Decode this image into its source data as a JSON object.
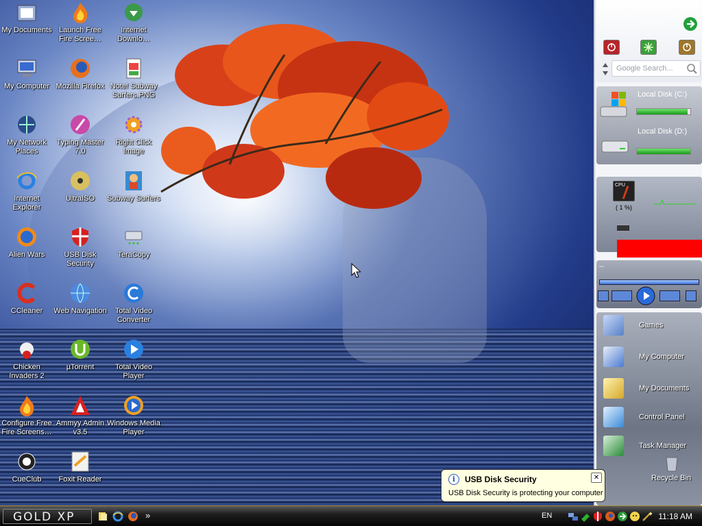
{
  "desktop_icons": [
    {
      "label": "My Documents",
      "icon": "folder-icon"
    },
    {
      "label": "Launch Free Fire Scree…",
      "icon": "flame-icon"
    },
    {
      "label": "Internet Downlo…",
      "icon": "globe-download-icon"
    },
    {
      "label": "My Computer",
      "icon": "computer-icon"
    },
    {
      "label": "Mozilla Firefox",
      "icon": "firefox-icon"
    },
    {
      "label": "Note! Subway Surfers.PNG",
      "icon": "image-file-icon"
    },
    {
      "label": "My Network Places",
      "icon": "network-icon"
    },
    {
      "label": "Typing Master 7.0",
      "icon": "typing-icon"
    },
    {
      "label": "Right Click Image",
      "icon": "gear-icon"
    },
    {
      "label": "Internet Explorer",
      "icon": "ie-icon"
    },
    {
      "label": "UltraISO",
      "icon": "disc-icon"
    },
    {
      "label": "Subway Surfers",
      "icon": "game-icon"
    },
    {
      "label": "Alien Wars",
      "icon": "alien-icon"
    },
    {
      "label": "USB Disk Security",
      "icon": "shield-icon"
    },
    {
      "label": "TeraCopy",
      "icon": "copy-icon"
    },
    {
      "label": "CCleaner",
      "icon": "ccleaner-icon"
    },
    {
      "label": "Web Navigation",
      "icon": "globe-icon"
    },
    {
      "label": "Total Video Converter",
      "icon": "converter-icon"
    },
    {
      "label": "Chicken Invaders 2",
      "icon": "chicken-icon"
    },
    {
      "label": "µTorrent",
      "icon": "utorrent-icon"
    },
    {
      "label": "Total Video Player",
      "icon": "play-icon"
    },
    {
      "label": "Configure Free Fire Screens…",
      "icon": "flame-icon"
    },
    {
      "label": "Ammyy Admin v3.5",
      "icon": "ammyy-icon"
    },
    {
      "label": "Windows Media Player",
      "icon": "media-player-icon"
    },
    {
      "label": "CueClub",
      "icon": "billiard-icon"
    },
    {
      "label": "Foxit Reader",
      "icon": "pdf-icon"
    }
  ],
  "sidebar": {
    "search_placeholder": "Google Search...",
    "disks": [
      {
        "label": "Local Disk (C:)",
        "used_fraction": 0.95
      },
      {
        "label": "Local Disk (D:)",
        "used_fraction": 1.0
      }
    ],
    "cpu": {
      "label": "CPU",
      "percent": "( 1 %)"
    },
    "media": {
      "track": "--"
    },
    "launcher": [
      {
        "label": "Games"
      },
      {
        "label": "My Computer"
      },
      {
        "label": "My Documents"
      },
      {
        "label": "Control Panel"
      },
      {
        "label": "Task Manager"
      }
    ],
    "recycle_bin": "Recycle Bin"
  },
  "taskbar": {
    "start_label": "GOLD XP",
    "language": "EN",
    "clock": "11:18 AM",
    "overflow": "»"
  },
  "balloon": {
    "title": "USB Disk Security",
    "body": "USB Disk Security is protecting your computer",
    "info": "i",
    "close": "✕"
  },
  "colors": {
    "taskbar_border": "#a78b2e",
    "disk_bar": "#1b9a1b",
    "cpu_alert": "#ff0000",
    "balloon_bg": "#ffffe1"
  }
}
